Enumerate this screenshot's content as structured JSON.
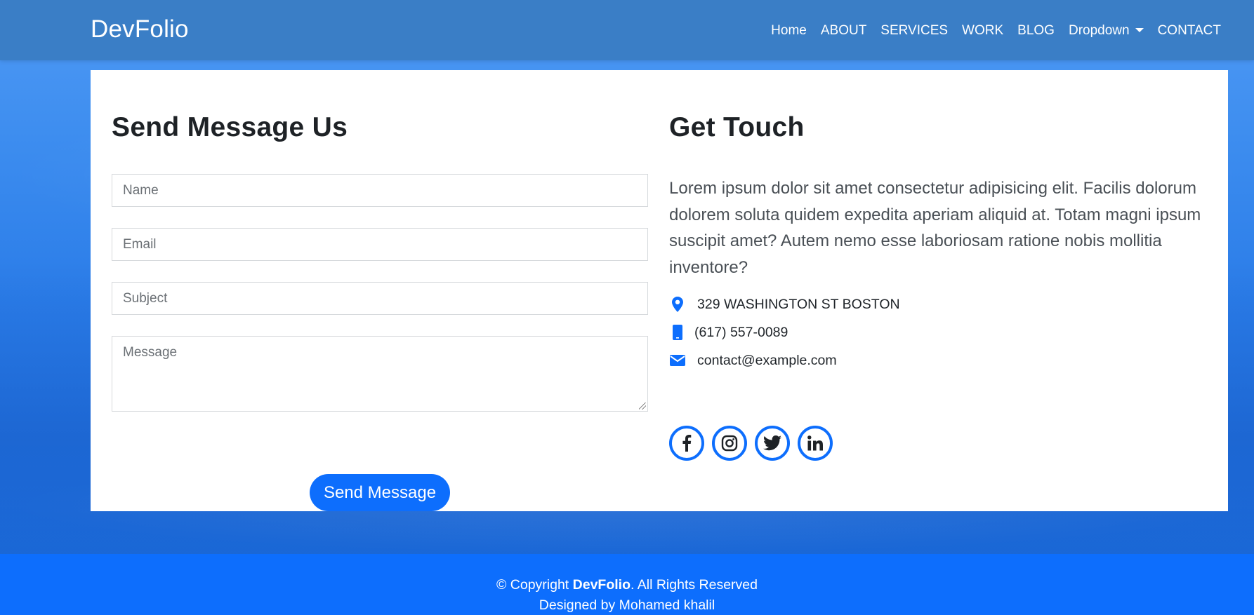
{
  "navbar": {
    "brand": "DevFolio",
    "links": [
      "Home",
      "ABOUT",
      "SERVICES",
      "WORK",
      "BLOG",
      "Dropdown",
      "CONTACT"
    ]
  },
  "form": {
    "title": "Send Message Us",
    "name_placeholder": "Name",
    "email_placeholder": "Email",
    "subject_placeholder": "Subject",
    "message_placeholder": "Message",
    "submit_label": "Send Message"
  },
  "info": {
    "title": "Get Touch",
    "paragraph": "Lorem ipsum dolor sit amet consectetur adipisicing elit. Facilis dolorum dolorem soluta quidem expedita aperiam aliquid at. Totam magni ipsum suscipit amet? Autem nemo esse laboriosam ratione nobis mollitia inventore?",
    "address": "329 WASHINGTON ST BOSTON",
    "phone": "(617) 557-0089",
    "email": "contact@example.com",
    "socials": [
      "facebook-icon",
      "instagram-icon",
      "twitter-icon",
      "linkedin-icon"
    ]
  },
  "footer": {
    "copyright_prefix": "© Copyright ",
    "copyright_brand": "DevFolio",
    "copyright_suffix": ". All Rights Reserved",
    "designed_by": "Designed by Mohamed khalil"
  },
  "colors": {
    "accent": "#0d6efd",
    "navbar": "#3a7ec6",
    "heading": "#1e2226"
  }
}
